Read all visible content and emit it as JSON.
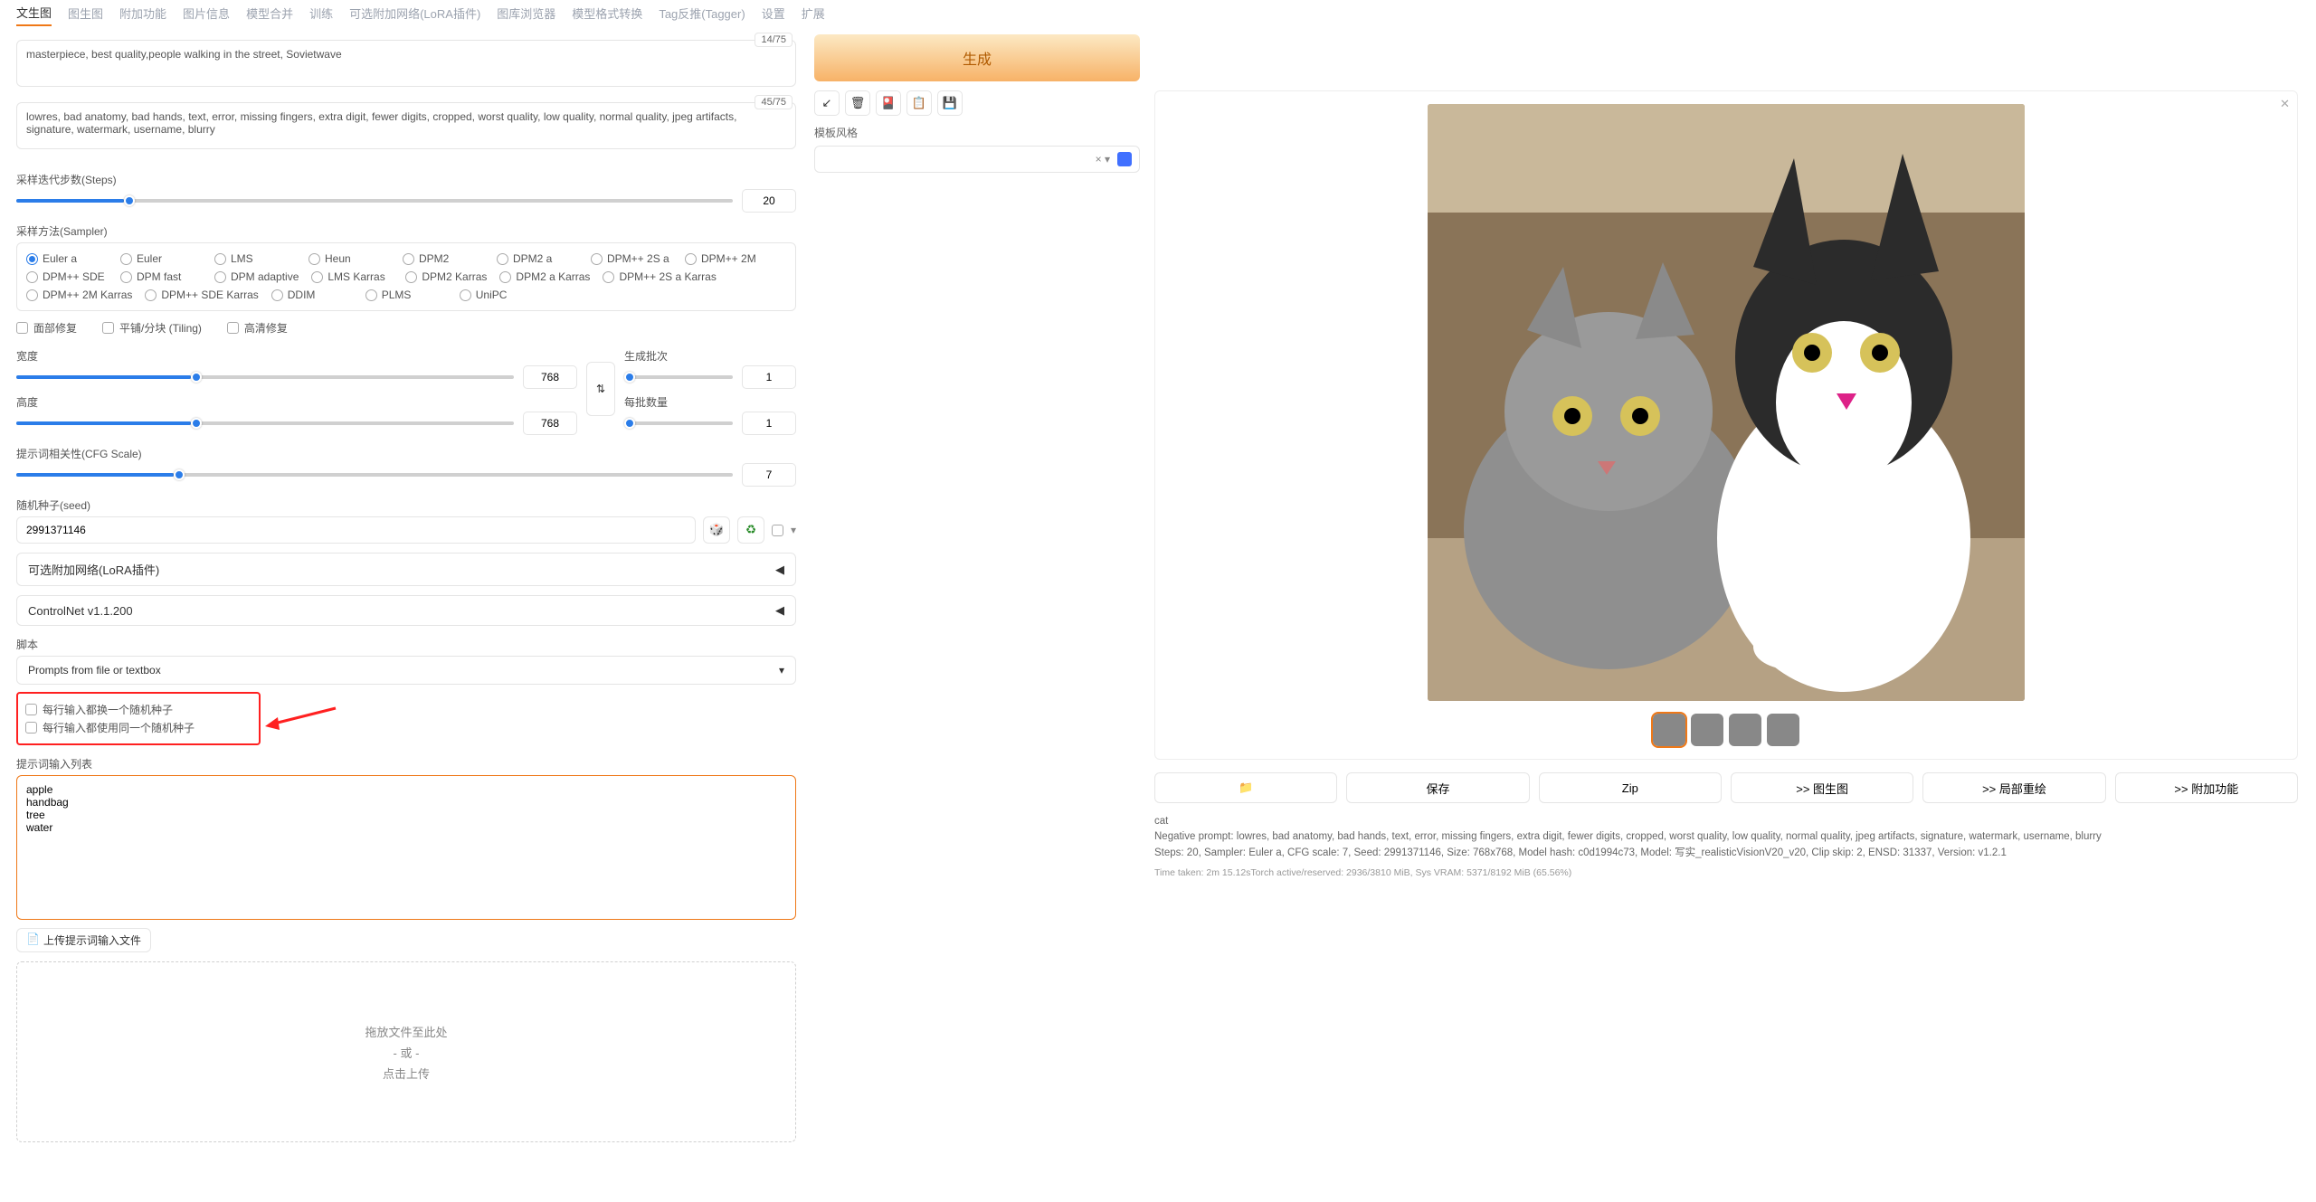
{
  "tabs": [
    "文生图",
    "图生图",
    "附加功能",
    "图片信息",
    "模型合并",
    "训练",
    "可选附加网络(LoRA插件)",
    "图库浏览器",
    "模型格式转换",
    "Tag反推(Tagger)",
    "设置",
    "扩展"
  ],
  "prompt": {
    "text": "masterpiece, best quality,people walking in the street, Sovietwave",
    "count": "14/75"
  },
  "neg": {
    "text": "lowres, bad anatomy, bad hands, text, error, missing fingers, extra digit, fewer digits, cropped, worst quality, low quality, normal quality, jpeg artifacts, signature, watermark, username, blurry",
    "count": "45/75"
  },
  "generate": "生成",
  "style_label": "模板风格",
  "steps": {
    "label": "采样迭代步数(Steps)",
    "value": "20",
    "pct": 15
  },
  "sampler": {
    "label": "采样方法(Sampler)",
    "options": [
      "Euler a",
      "Euler",
      "LMS",
      "Heun",
      "DPM2",
      "DPM2 a",
      "DPM++ 2S a",
      "DPM++ 2M",
      "DPM++ SDE",
      "DPM fast",
      "DPM adaptive",
      "LMS Karras",
      "DPM2 Karras",
      "DPM2 a Karras",
      "DPM++ 2S a Karras",
      "DPM++ 2M Karras",
      "DPM++ SDE Karras",
      "DDIM",
      "PLMS",
      "UniPC"
    ],
    "selected": "Euler a"
  },
  "fixes": {
    "face": "面部修复",
    "tiling": "平铺/分块 (Tiling)",
    "hires": "高清修复"
  },
  "width": {
    "label": "宽度",
    "value": "768",
    "pct": 35
  },
  "height": {
    "label": "高度",
    "value": "768",
    "pct": 35
  },
  "batch_count": {
    "label": "生成批次",
    "value": "1",
    "pct": 0
  },
  "batch_size": {
    "label": "每批数量",
    "value": "1",
    "pct": 0
  },
  "cfg": {
    "label": "提示词相关性(CFG Scale)",
    "value": "7",
    "pct": 22
  },
  "seed": {
    "label": "随机种子(seed)",
    "value": "2991371146"
  },
  "lora": "可选附加网络(LoRA插件)",
  "controlnet": "ControlNet v1.1.200",
  "script_label": "脚本",
  "script": "Prompts from file or textbox",
  "opt1": "每行输入都换一个随机种子",
  "opt2": "每行输入都使用同一个随机种子",
  "list_label": "提示词输入列表",
  "list_text": "apple\nhandbag\ntree\nwater",
  "upload": "上传提示词输入文件",
  "drop": {
    "l1": "拖放文件至此处",
    "l2": "- 或 -",
    "l3": "点击上传"
  },
  "actions": {
    "folder": "📁",
    "save": "保存",
    "zip": "Zip",
    "i2i": ">> 图生图",
    "inpaint": ">> 局部重绘",
    "extras": ">> 附加功能"
  },
  "out": {
    "prompt": "cat",
    "neg": "Negative prompt: lowres, bad anatomy, bad hands, text, error, missing fingers, extra digit, fewer digits, cropped, worst quality, low quality, normal quality, jpeg artifacts, signature, watermark, username, blurry",
    "params": "Steps: 20, Sampler: Euler a, CFG scale: 7, Seed: 2991371146, Size: 768x768, Model hash: c0d1994c73, Model: 写实_realisticVisionV20_v20, Clip skip: 2, ENSD: 31337, Version: v1.2.1",
    "time": "Time taken: 2m 15.12sTorch active/reserved: 2936/3810 MiB, Sys VRAM: 5371/8192 MiB (65.56%)"
  }
}
